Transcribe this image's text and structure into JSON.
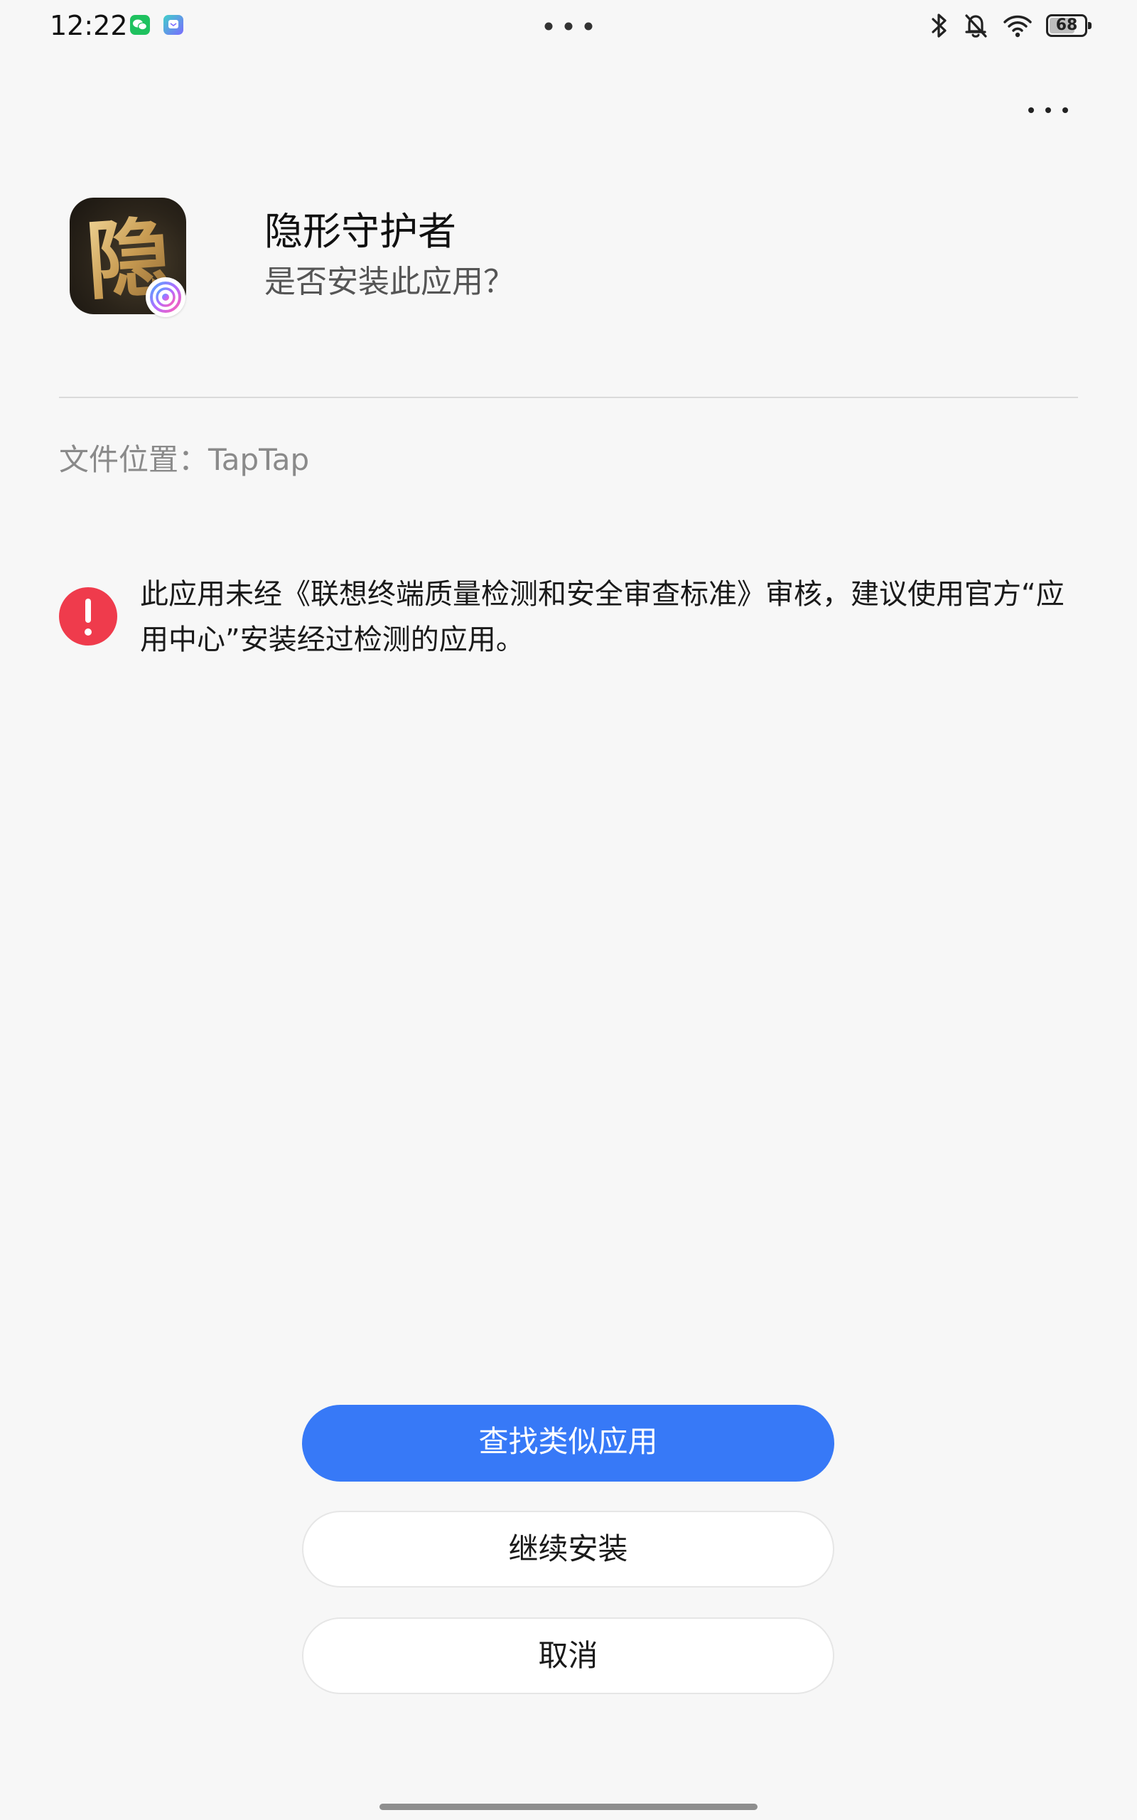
{
  "status_bar": {
    "time": "12:22",
    "notification_icons": [
      "wechat-icon",
      "message-app-icon"
    ],
    "system_icons": [
      "bluetooth-icon",
      "bell-muted-icon",
      "wifi-icon"
    ],
    "battery_level": "68"
  },
  "header": {
    "more_icon": "more-horizontal-icon"
  },
  "app": {
    "icon_glyph": "隐",
    "name": "隐形守护者",
    "question": "是否安装此应用？"
  },
  "file_location": "文件位置：TapTap",
  "warning": {
    "icon": "exclamation-circle-icon",
    "color": "#ef3b4c",
    "text": "此应用未经《联想终端质量检测和安全审查标准》审核，建议使用官方“应用中心”安装经过检测的应用。"
  },
  "buttons": {
    "find_similar": "查找类似应用",
    "continue_install": "继续安装",
    "cancel": "取消"
  },
  "colors": {
    "primary": "#3779f7",
    "background": "#f7f7f7"
  }
}
